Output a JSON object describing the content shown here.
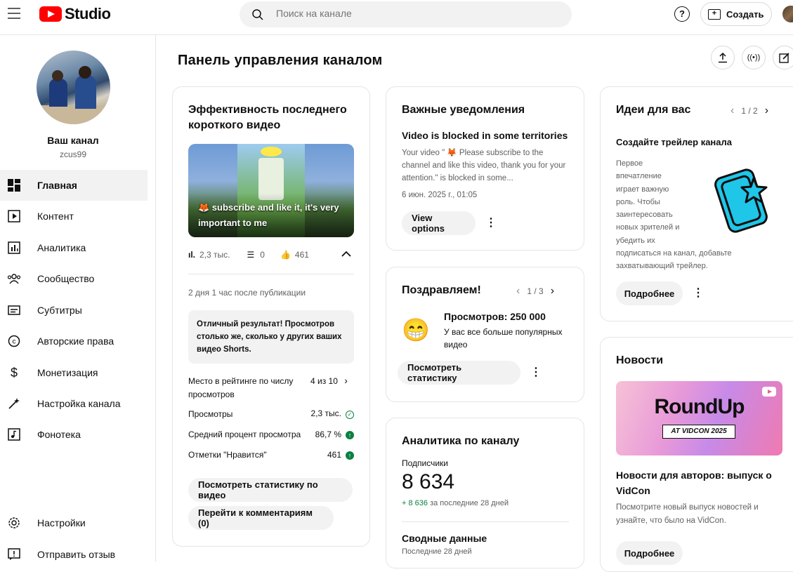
{
  "header": {
    "logo_text": "Studio",
    "search_placeholder": "Поиск на канале",
    "help_label": "?",
    "create_label": "Создать"
  },
  "sidebar": {
    "channel_name": "Ваш канал",
    "channel_handle": "zcus99",
    "items": [
      {
        "label": "Главная",
        "icon": "dashboard-icon",
        "active": true
      },
      {
        "label": "Контент",
        "icon": "content-icon"
      },
      {
        "label": "Аналитика",
        "icon": "analytics-icon"
      },
      {
        "label": "Сообщество",
        "icon": "community-icon"
      },
      {
        "label": "Субтитры",
        "icon": "subtitles-icon"
      },
      {
        "label": "Авторские права",
        "icon": "copyright-icon"
      },
      {
        "label": "Монетизация",
        "icon": "monetization-icon"
      },
      {
        "label": "Настройка канала",
        "icon": "customization-icon"
      },
      {
        "label": "Фонотека",
        "icon": "audio-library-icon"
      }
    ],
    "bottom_items": [
      {
        "label": "Настройки",
        "icon": "settings-icon"
      },
      {
        "label": "Отправить отзыв",
        "icon": "feedback-icon"
      }
    ]
  },
  "main": {
    "title": "Панель управления каналом"
  },
  "short_card": {
    "title": "Эффективность последнего короткого видео",
    "thumb_caption": "🦊 subscribe and like it, it's very important to me",
    "views": "2,3 тыс.",
    "comments": "0",
    "likes": "461",
    "since": "2 дня 1 час после публикации",
    "result_box": "Отличный результат! Просмотров столько же, сколько у других ваших видео Shorts.",
    "rank_label": "Место в рейтинге по числу просмотров",
    "rank_value": "4 из 10",
    "rows": [
      {
        "label": "Просмотры",
        "value": "2,3 тыс."
      },
      {
        "label": "Средний процент просмотра",
        "value": "86,7 %"
      },
      {
        "label": "Отметки \"Нравится\"",
        "value": "461"
      }
    ],
    "btn_stats": "Посмотреть статистику по видео",
    "btn_comments": "Перейти к комментариям (0)"
  },
  "notices_card": {
    "title": "Важные уведомления",
    "subtitle": "Video is blocked in some territories",
    "body": "Your video \" 🦊 Please subscribe to the channel and like this video, thank you for your attention.\" is blocked in some...",
    "date": "6 июн. 2025 г., 01:05",
    "btn": "View options"
  },
  "congrats_card": {
    "title": "Поздравляем!",
    "pager": "1 / 3",
    "headline": "Просмотров: 250 000",
    "text": "У вас все больше популярных видео",
    "emoji": "😁",
    "btn": "Посмотреть статистику"
  },
  "analytics_card": {
    "title": "Аналитика по каналу",
    "subs_label": "Подписчики",
    "subs_value": "8 634",
    "delta_value": "+ 8 636",
    "delta_text": "за последние 28 дней",
    "summary_title": "Сводные данные",
    "summary_sub": "Последние 28 дней"
  },
  "ideas_card": {
    "title": "Идеи для вас",
    "pager": "1 / 2",
    "subtitle": "Создайте трейлер канала",
    "text_lines": [
      "Первое",
      "впечатление",
      "играет важную",
      "роль. Чтобы",
      "заинтересовать",
      "новых зрителей и",
      "убедить их",
      "подписаться на канал, добавьте",
      "захватывающий трейлер."
    ],
    "btn": "Подробнее"
  },
  "news_card": {
    "title": "Новости",
    "banner_title": "RoundUp",
    "banner_tag": "AT VIDCON 2025",
    "headline": "Новости для авторов: выпуск о VidCon",
    "text": "Посмотрите новый выпуск новостей и узнайте, что было на VidCon.",
    "btn": "Подробнее"
  },
  "colors": {
    "brand_red": "#ff0000",
    "accent_green": "#0b8043",
    "trailer_cyan": "#1fc6e8"
  }
}
